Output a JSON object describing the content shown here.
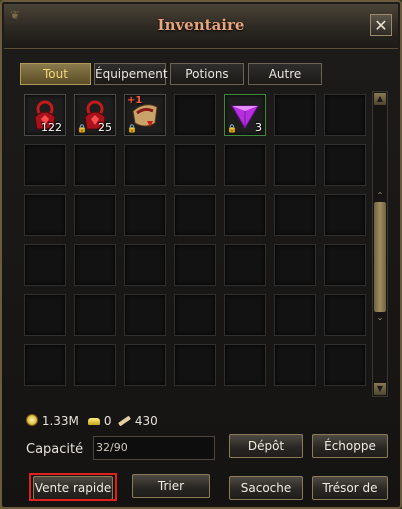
{
  "window": {
    "title": "Inventaire",
    "close_symbol": "✕"
  },
  "tabs": [
    {
      "label": "Tout",
      "active": true
    },
    {
      "label": "Équipement",
      "active": false
    },
    {
      "label": "Potions",
      "active": false
    },
    {
      "label": "Autre",
      "active": false
    }
  ],
  "items": [
    {
      "icon": "red-ring-bag-icon",
      "count": "122",
      "locked": false
    },
    {
      "icon": "red-ring-bag-icon",
      "count": "25",
      "locked": true
    },
    {
      "icon": "golden-armor-icon",
      "count": "",
      "locked": true,
      "enhance": "+1"
    },
    {
      "icon": "purple-gem-icon",
      "count": "3",
      "locked": true
    }
  ],
  "resources": {
    "gold": "1.33M",
    "ingots": "0",
    "scrolls": "430"
  },
  "capacity": {
    "label": "Capacité",
    "value": "32/90"
  },
  "buttons": {
    "depot": "Dépôt",
    "echoppe": "Échoppe",
    "vente_rapide": "Vente rapide",
    "trier": "Trier",
    "sacoche": "Sacoche",
    "tresor": "Trésor de"
  },
  "colors": {
    "title": "#e8a47b",
    "active_tab": "#f3d87a",
    "highlight": "#e0201c"
  }
}
